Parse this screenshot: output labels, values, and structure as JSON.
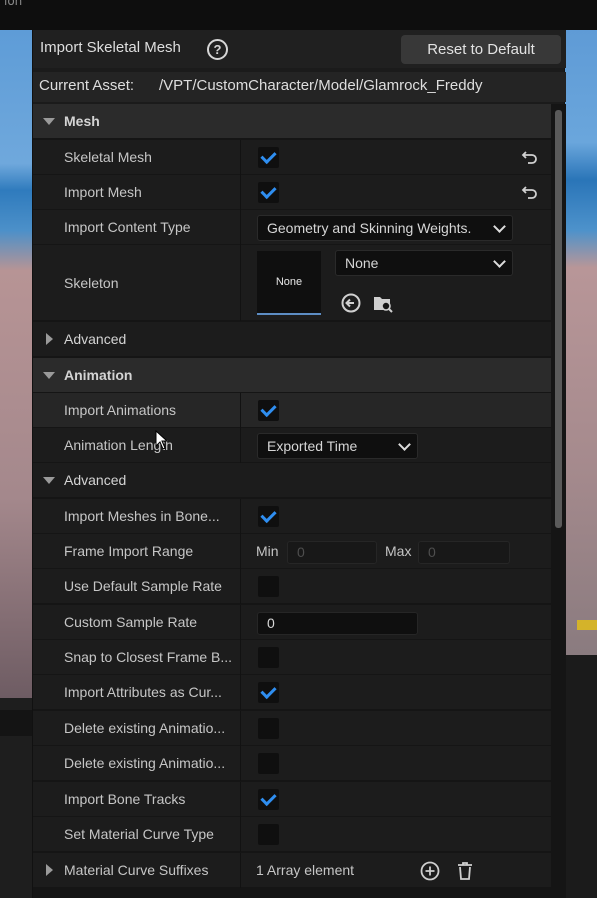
{
  "window": {
    "top_fragment": "ion"
  },
  "dialog": {
    "title": "Import Skeletal Mesh",
    "help_icon": "question-circle-icon",
    "reset_button": "Reset to Default",
    "current_asset_label": "Current Asset:",
    "current_asset_path": "/VPT/CustomCharacter/Model/Glamrock_Freddy"
  },
  "mesh": {
    "category": "Mesh",
    "skeletal_mesh": {
      "label": "Skeletal Mesh",
      "checked": true
    },
    "import_mesh": {
      "label": "Import Mesh",
      "checked": true
    },
    "import_content_type": {
      "label": "Import Content Type",
      "value": "Geometry and Skinning Weights."
    },
    "skeleton": {
      "label": "Skeleton",
      "thumbnail_text": "None",
      "value": "None"
    },
    "advanced": "Advanced"
  },
  "animation": {
    "category": "Animation",
    "import_animations": {
      "label": "Import Animations",
      "checked": true
    },
    "animation_length": {
      "label": "Animation Length",
      "value": "Exported Time"
    },
    "advanced": "Advanced",
    "rows": {
      "import_meshes_in_bone": {
        "label": "Import Meshes in Bone...",
        "checked": true
      },
      "frame_import_range": {
        "label": "Frame Import Range",
        "min_label": "Min",
        "min_value": "0",
        "max_label": "Max",
        "max_value": "0"
      },
      "use_default_sample_rate": {
        "label": "Use Default Sample Rate",
        "checked": false
      },
      "custom_sample_rate": {
        "label": "Custom Sample Rate",
        "value": "0"
      },
      "snap_to_closest_frame": {
        "label": "Snap to Closest Frame B...",
        "checked": false
      },
      "import_attributes_as_curves": {
        "label": "Import Attributes as Cur...",
        "checked": true
      },
      "delete_existing_animation_1": {
        "label": "Delete existing Animatio...",
        "checked": false
      },
      "delete_existing_animation_2": {
        "label": "Delete existing Animatio...",
        "checked": false
      },
      "import_bone_tracks": {
        "label": "Import Bone Tracks",
        "checked": true
      },
      "set_material_curve_type": {
        "label": "Set Material Curve Type",
        "checked": false
      },
      "material_curve_suffixes": {
        "label": "Material Curve Suffixes",
        "value": "1 Array element"
      }
    }
  },
  "colors": {
    "accent": "#2f8ef0",
    "panel": "#1c1c1c",
    "category": "#2b2b2b"
  }
}
